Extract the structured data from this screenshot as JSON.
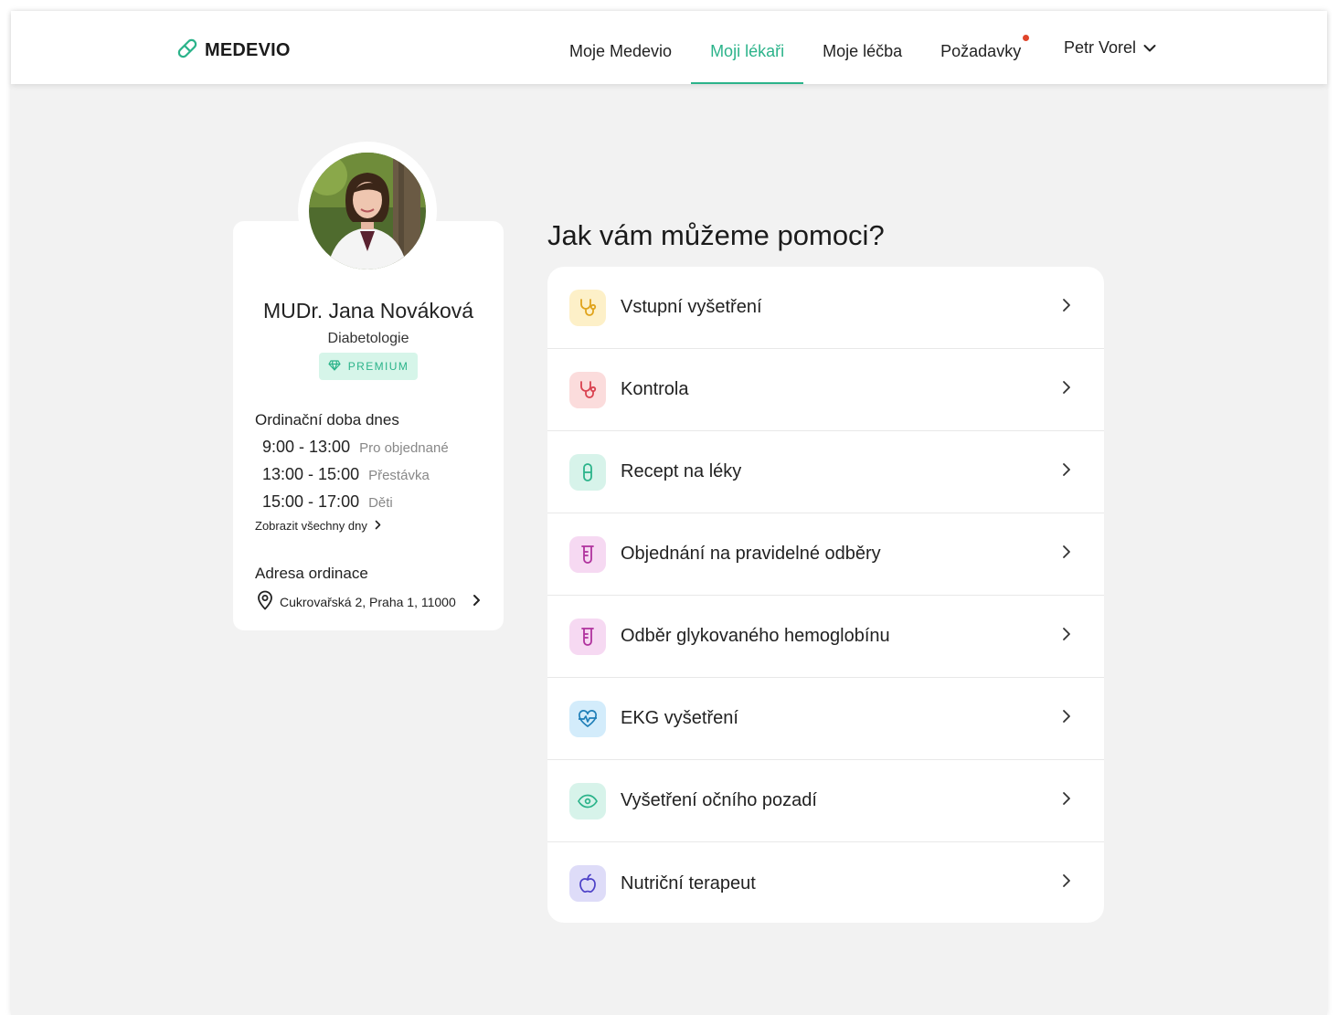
{
  "header": {
    "logo_text": "MEDEVIO",
    "nav": [
      {
        "label": "Moje Medevio"
      },
      {
        "label": "Moji lékaři"
      },
      {
        "label": "Moje léčba"
      },
      {
        "label": "Požadavky"
      }
    ],
    "active_nav": "Moji lékaři",
    "user_name": "Petr Vorel"
  },
  "doctor": {
    "name": "MUDr. Jana Nováková",
    "specialty": "Diabetologie",
    "badge": "PREMIUM",
    "hours_title": "Ordinační doba dnes",
    "hours": [
      {
        "time": "9:00 - 13:00",
        "note": "Pro objednané"
      },
      {
        "time": "13:00 - 15:00",
        "note": "Přestávka"
      },
      {
        "time": "15:00 - 17:00",
        "note": "Děti"
      }
    ],
    "show_all": "Zobrazit všechny dny",
    "address_title": "Adresa ordinace",
    "address": "Cukrovařská 2, Praha 1, 11000"
  },
  "services": {
    "heading": "Jak vám můžeme pomoci?",
    "items": [
      {
        "label": "Vstupní vyšetření",
        "icon": "stethoscope-icon"
      },
      {
        "label": "Kontrola",
        "icon": "stethoscope-icon"
      },
      {
        "label": "Recept na léky",
        "icon": "pill-icon"
      },
      {
        "label": "Objednání na pravidelné odběry",
        "icon": "test-tube-icon"
      },
      {
        "label": "Odběr glykovaného hemoglobínu",
        "icon": "test-tube-icon"
      },
      {
        "label": "EKG vyšetření",
        "icon": "heart-pulse-icon"
      },
      {
        "label": "Vyšetření očního pozadí",
        "icon": "eye-icon"
      },
      {
        "label": "Nutriční terapeut",
        "icon": "apple-icon"
      }
    ]
  },
  "colors": {
    "accent": "#2bb38a",
    "notification": "#e0452b",
    "background": "#f2f2f2"
  }
}
